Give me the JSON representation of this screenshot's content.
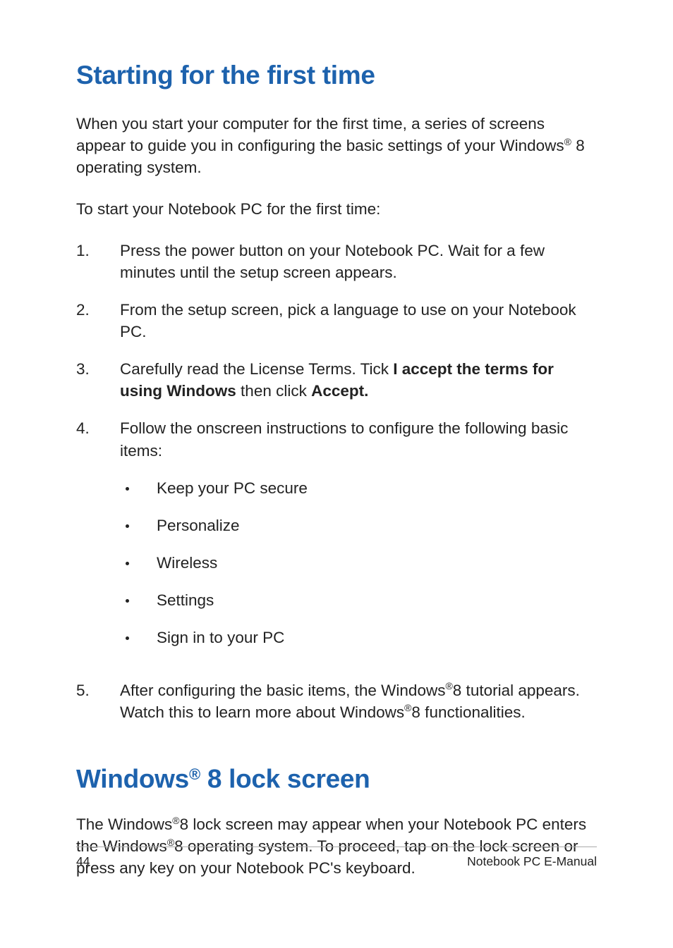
{
  "heading1": "Starting for the first time",
  "intro_p1_a": "When you start your computer for the first time, a series of screens appear to guide you in configuring the basic settings of your Windows",
  "intro_p1_b": " 8 operating system.",
  "intro_p2": "To start your Notebook PC for the first time:",
  "steps": [
    {
      "num": "1.",
      "text": "Press the power button on your Notebook PC. Wait for a few minutes until the setup screen appears."
    },
    {
      "num": "2.",
      "text": "From the setup screen, pick a language to use on your Notebook PC."
    },
    {
      "num": "3.",
      "pre": "Carefully read the License Terms. Tick ",
      "bold1": "I accept the terms for using Windows",
      "mid": " then click ",
      "bold2": "Accept."
    },
    {
      "num": "4.",
      "text": "Follow the onscreen instructions to configure the following basic items:"
    },
    {
      "num": "5.",
      "pre": "After configuring the basic items, the Windows",
      "mid": "8 tutorial appears. Watch this to learn more about Windows",
      "post": "8 functionalities."
    }
  ],
  "bullets": [
    "Keep your PC secure",
    "Personalize",
    "Wireless",
    "Settings",
    "Sign in to your PC"
  ],
  "heading2_a": "Windows",
  "heading2_b": " 8 lock screen",
  "p3_a": "The Windows",
  "p3_b": "8 lock screen may appear when your Notebook PC enters the Windows",
  "p3_c": "8 operating system. To proceed,  tap on the lock screen or press any key on your Notebook PC's keyboard.",
  "reg": "®",
  "footer_page": "44",
  "footer_title": "Notebook PC E-Manual"
}
